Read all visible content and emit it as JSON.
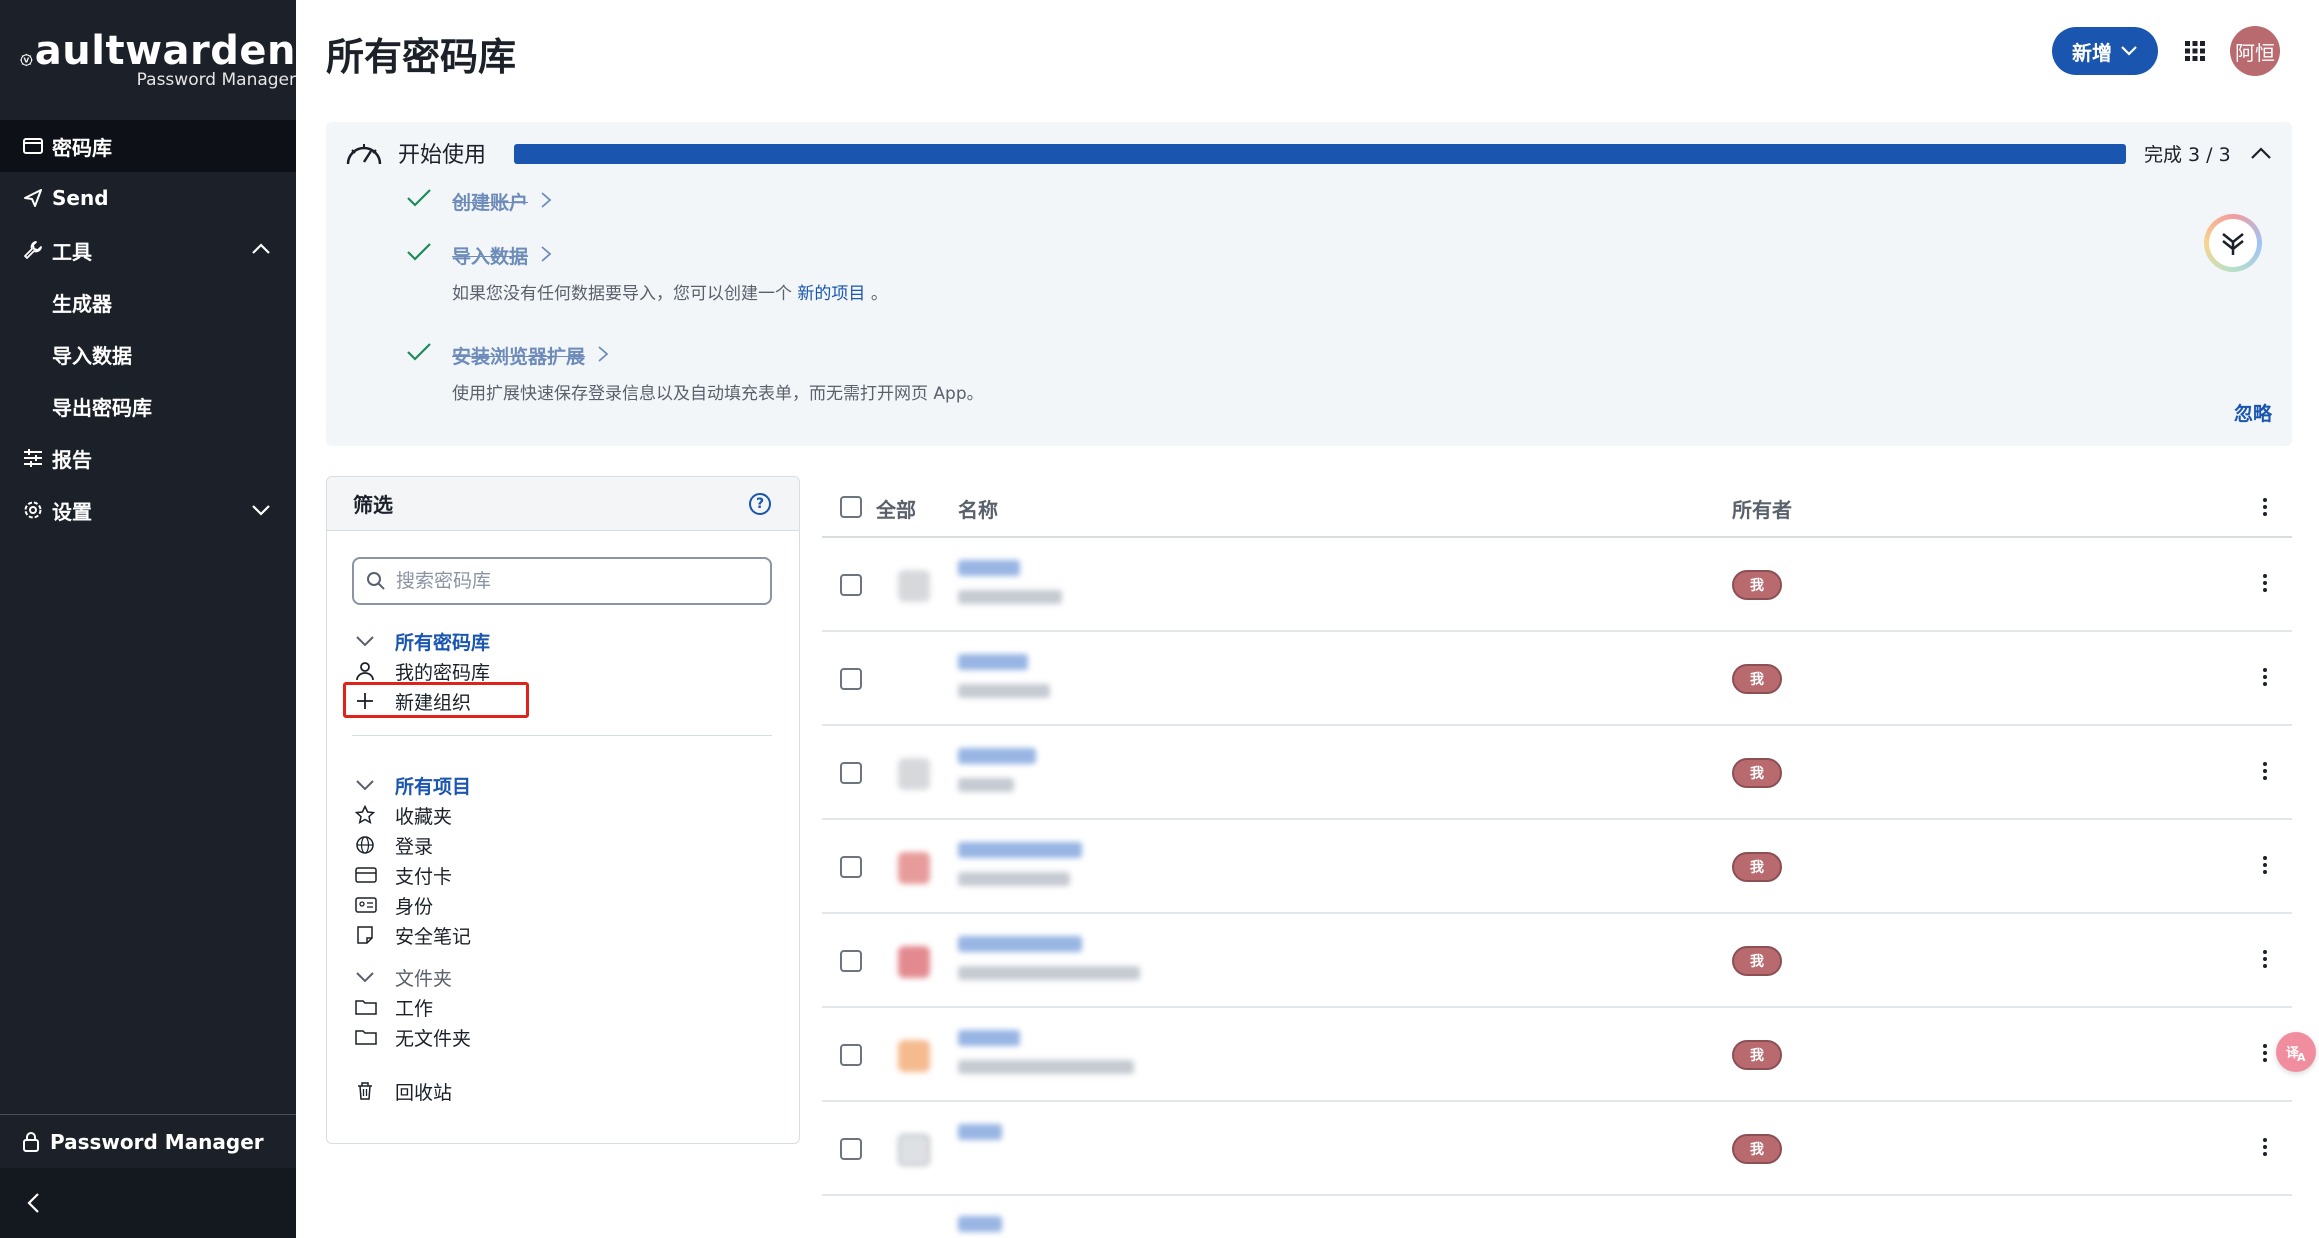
{
  "brand": {
    "word": "aultwarden",
    "initial": "V",
    "sub": "Password Manager"
  },
  "sidebar": {
    "items": [
      {
        "label": "密码库",
        "icon": "vault-icon"
      },
      {
        "label": "Send",
        "icon": "send-icon"
      },
      {
        "label": "工具",
        "icon": "wrench-icon"
      },
      {
        "label": "生成器"
      },
      {
        "label": "导入数据"
      },
      {
        "label": "导出密码库"
      },
      {
        "label": "报告",
        "icon": "sliders-icon"
      },
      {
        "label": "设置",
        "icon": "gear-icon"
      }
    ],
    "footer_label": "Password Manager"
  },
  "header": {
    "title": "所有密码库",
    "new_label": "新增",
    "avatar": "阿恒"
  },
  "getting_started": {
    "title": "开始使用",
    "status": "完成 3 / 3",
    "progress": 1.0,
    "steps": [
      {
        "title": "创建账户",
        "desc": ""
      },
      {
        "title": "导入数据",
        "desc_pre": "如果您没有任何数据要导入，您可以创建一个",
        "desc_link": "新的项目",
        "desc_post": "。"
      },
      {
        "title": "安装浏览器扩展",
        "desc": "使用扩展快速保存登录信息以及自动填充表单，而无需打开网页 App。"
      }
    ],
    "dismiss": "忽略"
  },
  "filter": {
    "title": "筛选",
    "help": "?",
    "search_placeholder": "搜索密码库",
    "vaults_header": "所有密码库",
    "my_vault": "我的密码库",
    "new_org": "新建组织",
    "items_header": "所有项目",
    "types": [
      "收藏夹",
      "登录",
      "支付卡",
      "身份",
      "安全笔记"
    ],
    "folders_header": "文件夹",
    "folders": [
      "工作",
      "无文件夹"
    ],
    "trash": "回收站"
  },
  "table": {
    "all_label": "全部",
    "col_name": "名称",
    "col_owner": "所有者",
    "owner_badge": "我",
    "rows": 7
  },
  "colors": {
    "sidebar": "#1b2029",
    "accent": "#1a56b0",
    "owner": "#b86a6e"
  }
}
